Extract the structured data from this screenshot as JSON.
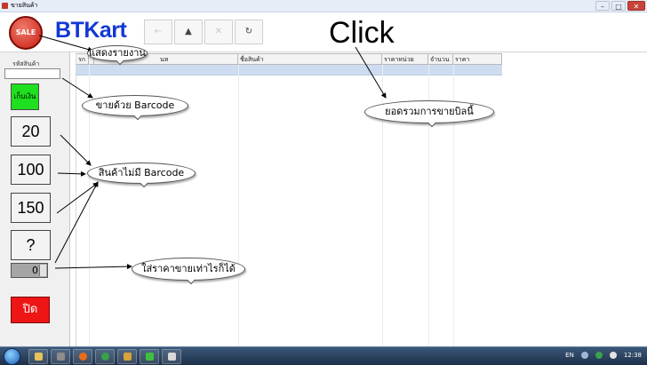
{
  "window": {
    "title": "ขายสินค้า"
  },
  "toolbar": {
    "logo_text": "SALE",
    "brand": "BTKart",
    "buttons": [
      "←",
      "▲",
      "✕",
      "↻"
    ],
    "click_label": "Click"
  },
  "left_panel": {
    "code_label": "รหัสสินค้า",
    "code_value": "",
    "pay_label": "เก็บเงิน",
    "amounts": [
      "20",
      "100",
      "150",
      "?"
    ],
    "price_value": "0",
    "close_label": "ปิด"
  },
  "grid": {
    "columns": [
      "รก",
      "",
      "นห",
      "ชื่อสินค้า",
      "ราคาหน่วย",
      "จำนวน",
      "ราคา"
    ]
  },
  "callouts": {
    "report": "แสดงรายงาน",
    "barcode_sale": "ขายด้วย Barcode",
    "no_barcode": "สินค้าไม่มี Barcode",
    "any_price": "ใส่ราคาขายเท่าไรก็ได้",
    "bill_total": "ยอดรวมการขายบิลนี้"
  },
  "taskbar": {
    "language": "EN",
    "clock": "12:38"
  },
  "colors": {
    "brand": "#1338d4",
    "pay_button": "#1ee01e",
    "close_button": "#ee1515",
    "selected_row": "#cddcf0"
  }
}
